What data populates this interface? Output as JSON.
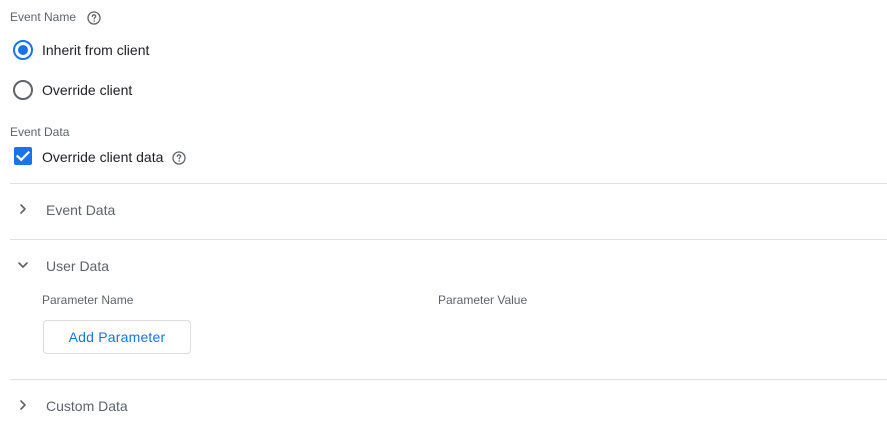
{
  "event_name": {
    "label": "Event Name",
    "help_icon": "help-circle-icon",
    "options": [
      {
        "label": "Inherit from client",
        "selected": true
      },
      {
        "label": "Override client",
        "selected": false
      }
    ]
  },
  "event_data": {
    "label": "Event Data",
    "override_checkbox": {
      "label": "Override client data",
      "checked": true
    },
    "help_icon": "help-circle-icon"
  },
  "sections": [
    {
      "title": "Event Data",
      "expanded": false
    },
    {
      "title": "User Data",
      "expanded": true
    },
    {
      "title": "Custom Data",
      "expanded": false
    }
  ],
  "user_data_table": {
    "columns": [
      "Parameter Name",
      "Parameter Value"
    ],
    "add_button_label": "Add Parameter"
  },
  "colors": {
    "accent": "#1a73e8",
    "text_primary": "#202124",
    "text_secondary": "#5f6368",
    "divider": "#e0e0e0",
    "radio_unselected": "#5f6368"
  }
}
